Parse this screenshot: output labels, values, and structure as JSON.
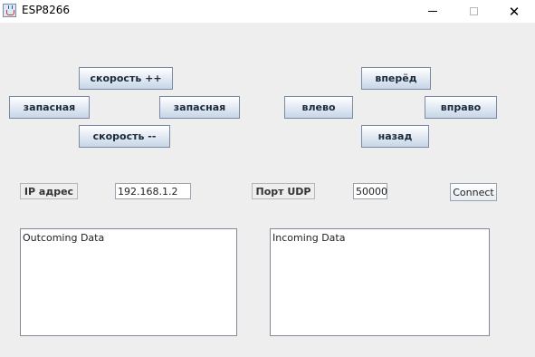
{
  "window": {
    "title": "ESP8266",
    "minimize_glyph": "",
    "close_glyph": "✕"
  },
  "speed": {
    "up_label": "скорость ++",
    "down_label": "скорость --",
    "spare_left_label": "запасная",
    "spare_right_label": "запасная"
  },
  "direction": {
    "forward_label": "вперёд",
    "left_label": "влево",
    "right_label": "вправо",
    "back_label": "назад"
  },
  "connection": {
    "ip_label": "IP адрес",
    "ip_value": "192.168.1.2",
    "port_label": "Порт UDP",
    "port_value": "50000",
    "connect_label": "Connect"
  },
  "data": {
    "outgoing_text": "Outcoming Data",
    "incoming_text": "Incoming Data"
  },
  "icons": {
    "app": "java-coffee-cup-icon"
  }
}
